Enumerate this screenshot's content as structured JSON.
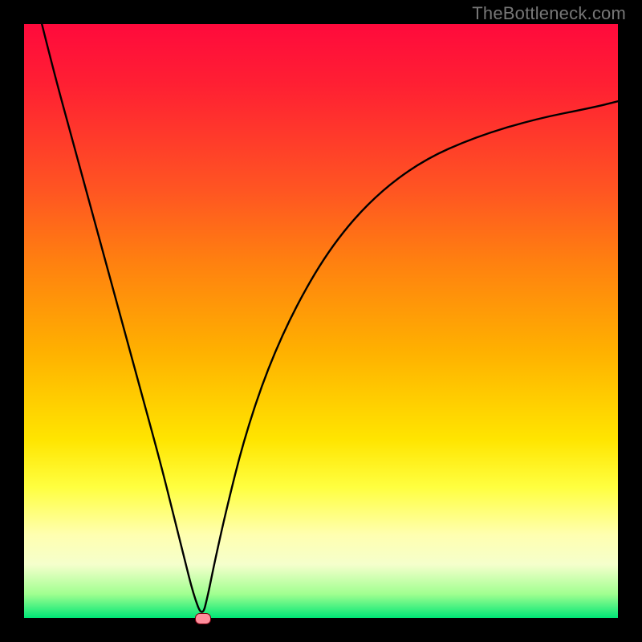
{
  "watermark": "TheBottleneck.com",
  "chart_data": {
    "type": "line",
    "title": "",
    "xlabel": "",
    "ylabel": "",
    "xlim": [
      0,
      100
    ],
    "ylim": [
      0,
      100
    ],
    "grid": false,
    "legend": false,
    "background_gradient": {
      "top": "#ff0a3c",
      "middle": "#ffe500",
      "bottom": "#00e676"
    },
    "series": [
      {
        "name": "curve",
        "color": "#000000",
        "x": [
          3,
          5,
          8,
          11,
          14,
          17,
          20,
          23,
          25,
          27,
          28.5,
          30,
          31,
          32,
          34,
          37,
          41,
          46,
          52,
          59,
          67,
          76,
          86,
          96,
          100
        ],
        "y": [
          100,
          92,
          81,
          70,
          59,
          48,
          37,
          26,
          18,
          10,
          4,
          0,
          4,
          9,
          18,
          30,
          42,
          53,
          63,
          71,
          77,
          81,
          84,
          86,
          87
        ]
      }
    ],
    "marker": {
      "shape": "rounded-rect",
      "color": "#ff8d9b",
      "border": "#7a0010",
      "x": 30,
      "y": 0
    }
  }
}
